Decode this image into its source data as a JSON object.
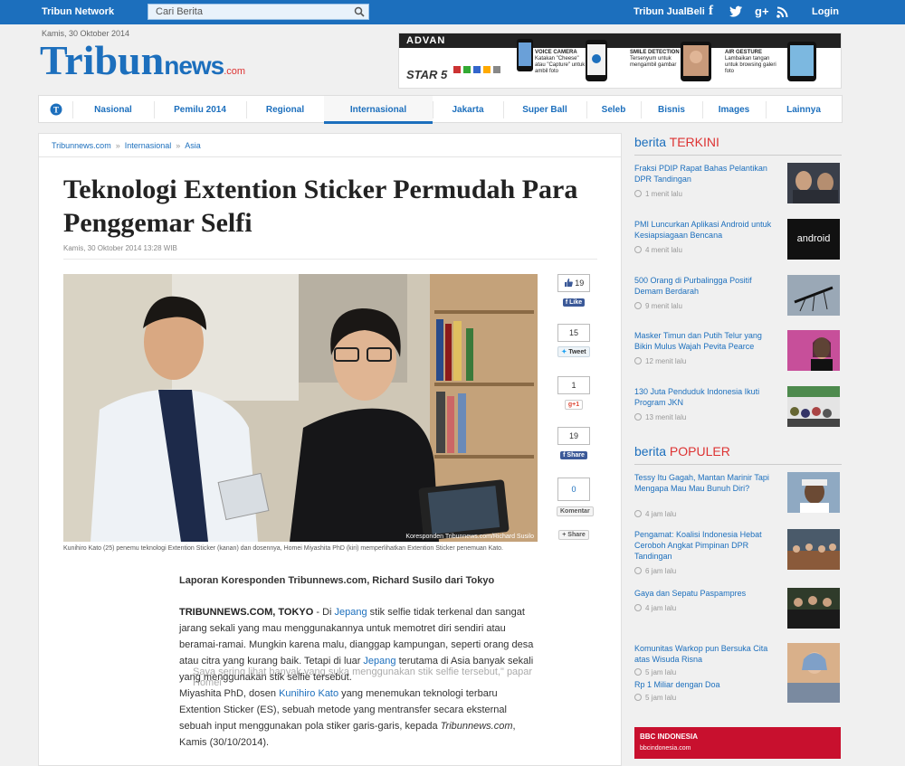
{
  "topbar": {
    "brand": "Tribun Network",
    "search_placeholder": "Cari Berita",
    "jualbeli": "Tribun JualBeli",
    "login": "Login"
  },
  "header": {
    "date": "Kamis, 30 Oktober 2014",
    "logo_main": "Tribun",
    "logo_news": "news",
    "logo_com": ".com"
  },
  "ad": {
    "brand": "ADVAN",
    "model": "STAR 5",
    "features": [
      {
        "title": "VOICE CAMERA",
        "text": "Katakan \"Cheese\" atau \"Capture\" untuk ambil foto"
      },
      {
        "title": "SMILE DETECTION",
        "text": "Tersenyum untuk mengambil gambar"
      },
      {
        "title": "AIR GESTURE",
        "text": "Lambaikan tangan untuk browsing galeri foto"
      }
    ]
  },
  "nav": [
    "Nasional",
    "Pemilu 2014",
    "Regional",
    "Internasional",
    "Jakarta",
    "Super Ball",
    "Seleb",
    "Bisnis",
    "Images",
    "Lainnya"
  ],
  "article": {
    "breadcrumb": [
      "Tribunnews.com",
      "Internasional",
      "Asia"
    ],
    "title": "Teknologi Extention Sticker Permudah Para Penggemar Selfi",
    "meta": "Kamis, 30 Oktober 2014 13:28 WIB",
    "photo_credit": "Koresponden Tribunnews.com/Richard Susilo",
    "caption": "Kunihiro Kato (25) penemu teknologi Extention Sticker (kanan) dan dosennya, Homei Miyashita PhD (kiri) memperlihatkan Extention Sticker penemuan Kato.",
    "byline": "Laporan Koresponden Tribunnews.com, Richard Susilo dari Tokyo",
    "p1_lead": "TRIBUNNEWS.COM, TOKYO",
    "p1_a": " - Di ",
    "p1_link1": "Jepang",
    "p1_b": " stik selfie tidak terkenal dan sangat jarang sekali yang mau menggunakannya untuk memotret diri sendiri atau beramai-ramai. Mungkin karena malu, dianggap kampungan, seperti orang desa atau citra yang kurang baik. Tetapi di luar ",
    "p1_link2": "Jepang",
    "p1_c": " terutama di Asia banyak sekali yang menggunakan stik selfie tersebut.",
    "p2_a": "Miyashita PhD, dosen ",
    "p2_link": "Kunihiro Kato",
    "p2_b": " yang menemukan teknologi terbaru Extention Sticker (ES), sebuah metode yang mentransfer secara eksternal sebuah input menggunakan pola stiker garis-garis, kepada ",
    "p2_i": "Tribunnews.com",
    "p2_c": ", Kamis (30/10/2014).",
    "ghost": "Saya sering lihat banyak yang suka menggunakan stik selfie tersebut,\" papar Homei"
  },
  "share": {
    "fb_like_count": "19",
    "fb_like": "Like",
    "tweet_count": "15",
    "tweet": "Tweet",
    "gplus_count": "1",
    "gplus": "g+1",
    "fb_share_count": "19",
    "fb_share": "Share",
    "comment_count": "0",
    "comment": "Komentar",
    "share_more": "+ Share"
  },
  "sidebar": {
    "terkini_a": "berita ",
    "terkini_b": "TERKINI",
    "terkini": [
      {
        "title": "Fraksi PDIP Rapat Bahas Pelantikan DPR Tandingan",
        "time": "1 menit lalu"
      },
      {
        "title": "PMI Luncurkan Aplikasi Android untuk Kesiapsiagaan Bencana",
        "time": "4 menit lalu"
      },
      {
        "title": "500 Orang di Purbalingga Positif Demam Berdarah",
        "time": "9 menit lalu"
      },
      {
        "title": "Masker Timun dan Putih Telur yang Bikin Mulus Wajah Pevita Pearce",
        "time": "12 menit lalu"
      },
      {
        "title": "130 Juta Penduduk Indonesia Ikuti Program JKN",
        "time": "13 menit lalu"
      }
    ],
    "android_thumb": "android",
    "populer_a": "berita ",
    "populer_b": "POPULER",
    "populer": [
      {
        "title": "Tessy Itu Gagah, Mantan Marinir Tapi Mengapa Mau Mau Bunuh Diri?",
        "time": "4 jam lalu"
      },
      {
        "title": "Pengamat: Koalisi Indonesia Hebat Ceroboh Angkat Pimpinan DPR Tandingan",
        "time": "6 jam lalu"
      },
      {
        "title": "Gaya dan Sepatu Paspampres",
        "time": "4 jam lalu"
      },
      {
        "title": "Komunitas Warkop pun Bersuka Cita atas Wisuda Risna",
        "time": "5 jam lalu"
      },
      {
        "title": "Rp 1 Miliar dengan Doa",
        "time": "5 jam lalu"
      }
    ],
    "bbc_title": "BBC INDONESIA",
    "bbc_url": "bbcindonesia.com"
  },
  "colors": {
    "brand_blue": "#1c6fbd",
    "accent_red": "#d33"
  }
}
